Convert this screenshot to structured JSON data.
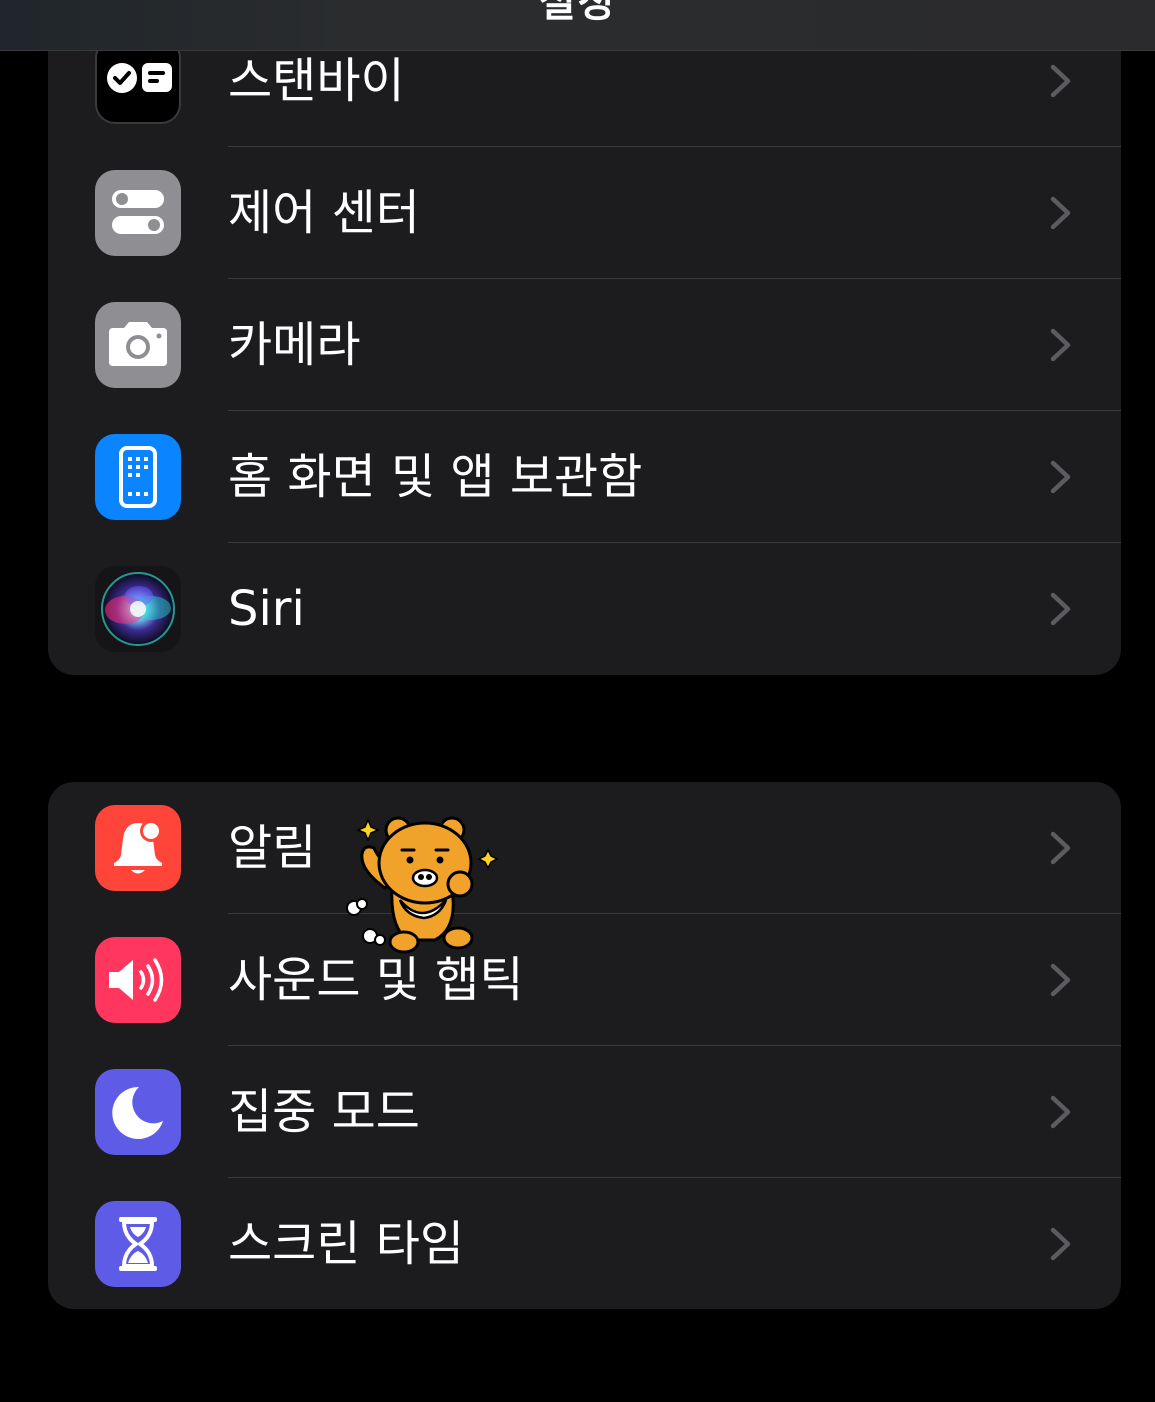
{
  "nav": {
    "title": "설정"
  },
  "groups": [
    {
      "items": [
        {
          "label": "스탠바이",
          "icon": "standby-icon"
        },
        {
          "label": "제어 센터",
          "icon": "control-center-icon"
        },
        {
          "label": "카메라",
          "icon": "camera-icon"
        },
        {
          "label": "홈 화면 및 앱 보관함",
          "icon": "home-screen-icon"
        },
        {
          "label": "Siri",
          "icon": "siri-icon"
        }
      ]
    },
    {
      "items": [
        {
          "label": "알림",
          "icon": "notifications-bell-icon"
        },
        {
          "label": "사운드 및 햅틱",
          "icon": "speaker-icon"
        },
        {
          "label": "집중 모드",
          "icon": "moon-icon"
        },
        {
          "label": "스크린 타임",
          "icon": "hourglass-icon"
        }
      ]
    }
  ],
  "colors": {
    "background": "#000000",
    "group_background": "#1c1c1e",
    "separator": "#3a3a3c",
    "chevron": "#5b5b60",
    "standby": "#000000",
    "control_center": "#8e8e93",
    "camera": "#8e8e93",
    "home_screen": "#0a84ff",
    "notifications": "#ff453a",
    "sounds": "#ff375f",
    "focus": "#5e5ce6",
    "screen_time": "#5e5ce6",
    "sticker": "#f0a22b"
  },
  "decoration": {
    "sticker": "kakao-ryan-sticker"
  }
}
